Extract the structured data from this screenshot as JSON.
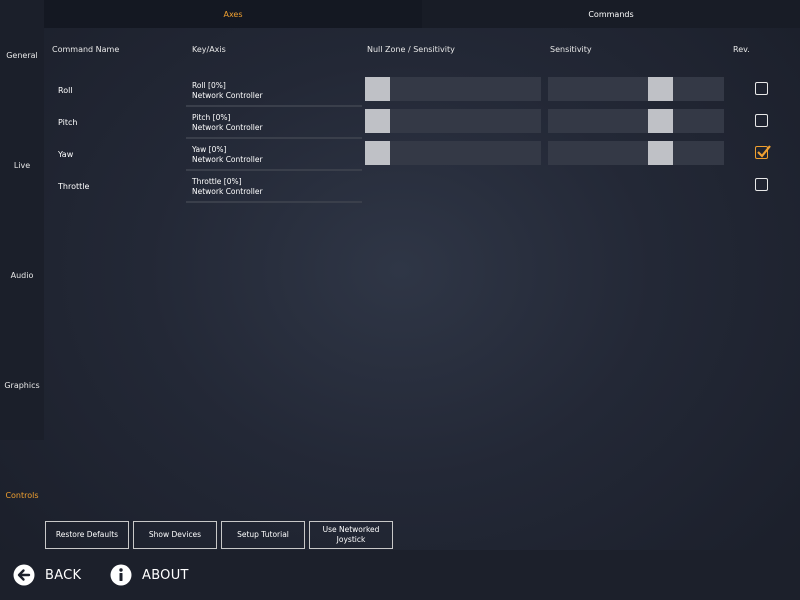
{
  "sidebar": {
    "items": [
      {
        "label": "General"
      },
      {
        "label": "Live"
      },
      {
        "label": "Audio"
      },
      {
        "label": "Graphics"
      },
      {
        "label": "Controls"
      }
    ]
  },
  "tabs": [
    {
      "label": "Axes"
    },
    {
      "label": "Commands"
    }
  ],
  "columns": {
    "command_name": "Command Name",
    "key_axis": "Key/Axis",
    "null_zone": "Null Zone / Sensitivity",
    "sensitivity": "Sensitivity",
    "rev": "Rev."
  },
  "rows": [
    {
      "name": "Roll",
      "axis": "Roll [0%]",
      "device": "Network Controller",
      "null_zone": 0,
      "sensitivity": 1,
      "rev": false,
      "has_sliders": true
    },
    {
      "name": "Pitch",
      "axis": "Pitch [0%]",
      "device": "Network Controller",
      "null_zone": 0,
      "sensitivity": 1,
      "rev": false,
      "has_sliders": true
    },
    {
      "name": "Yaw",
      "axis": "Yaw [0%]",
      "device": "Network Controller",
      "null_zone": 0,
      "sensitivity": 1,
      "rev": true,
      "has_sliders": true
    },
    {
      "name": "Throttle",
      "axis": "Throttle [0%]",
      "device": "Network Controller",
      "rev": false,
      "has_sliders": false
    }
  ],
  "buttons": {
    "restore_defaults": "Restore Defaults",
    "show_devices": "Show Devices",
    "setup_tutorial": "Setup Tutorial",
    "use_networked_joystick_1": "Use Networked",
    "use_networked_joystick_2": "Joystick"
  },
  "footer": {
    "back": "BACK",
    "about": "ABOUT"
  },
  "colors": {
    "accent": "#f0a030"
  }
}
